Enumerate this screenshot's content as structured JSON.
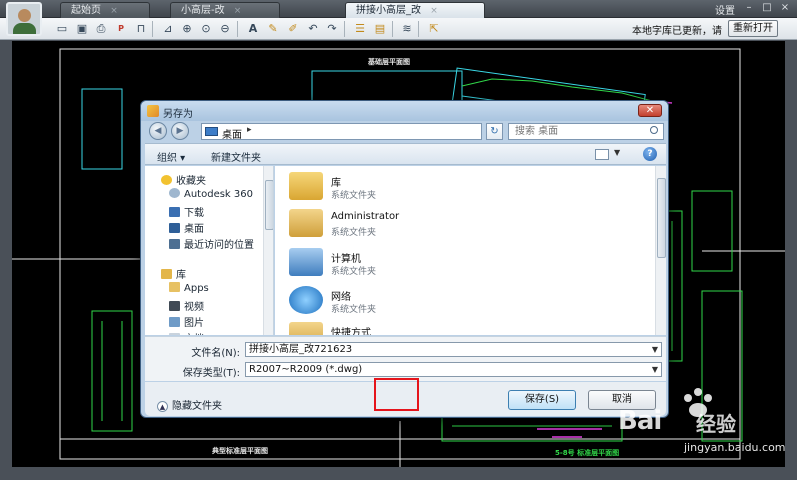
{
  "app": {
    "tabs": [
      {
        "label": "起始页",
        "active": false
      },
      {
        "label": "小高层-改",
        "active": false
      },
      {
        "label": "拼接小高层_改",
        "active": true
      }
    ],
    "settings_label": "设置",
    "window_buttons": {
      "minimize": "–",
      "maximize": "□",
      "close": "×"
    },
    "notice": "本地字库已更新，请",
    "reopen_label": "重新打开"
  },
  "toolbar": {
    "icons": [
      "open-icon",
      "save-icon",
      "print-icon",
      "pdf-icon",
      "lock-icon",
      "measure-icon",
      "zoom-in-icon",
      "zoom-window-icon",
      "zoom-out-icon",
      "text-icon",
      "pen-icon",
      "highlighter-icon",
      "undo-icon",
      "redo-icon",
      "layer-icon",
      "layout-icon",
      "stack-icon",
      "export-icon"
    ]
  },
  "cad": {
    "labels": [
      "典型标准层平面图",
      "基础层平面图",
      "5-8号 标准层平面图"
    ],
    "colors": {
      "line_white": "#e8e8e8",
      "line_green": "#31d84a",
      "line_cyan": "#3ad8e6",
      "line_magenta": "#e040e0"
    }
  },
  "dialog": {
    "title": "另存为",
    "close_label": "✕",
    "back_label": "◀",
    "forward_label": "▶",
    "address": "桌面",
    "address_sep": "▸",
    "refresh_label": "↻",
    "search_placeholder": "搜索 桌面",
    "organize_label": "组织 ▾",
    "new_folder_label": "新建文件夹",
    "help_label": "?",
    "nav": [
      {
        "label": "收藏夹",
        "icon": "star-icon",
        "header": true
      },
      {
        "label": "Autodesk 360",
        "icon": "cloud-icon"
      },
      {
        "label": "下载",
        "icon": "download-folder-icon"
      },
      {
        "label": "桌面",
        "icon": "desktop-icon"
      },
      {
        "label": "最近访问的位置",
        "icon": "recent-icon"
      },
      {
        "label": "库",
        "icon": "library-icon",
        "header": true
      },
      {
        "label": "Apps",
        "icon": "folder-icon"
      },
      {
        "label": "视频",
        "icon": "video-icon"
      },
      {
        "label": "图片",
        "icon": "picture-icon"
      },
      {
        "label": "文档",
        "icon": "document-icon"
      }
    ],
    "files": [
      {
        "name": "库",
        "type": "系统文件夹",
        "icon": "library-folder-icon"
      },
      {
        "name": "Administrator",
        "type": "系统文件夹",
        "icon": "user-folder-icon"
      },
      {
        "name": "计算机",
        "type": "系统文件夹",
        "icon": "computer-icon"
      },
      {
        "name": "网络",
        "type": "系统文件夹",
        "icon": "network-icon"
      },
      {
        "name": "快捷方式",
        "type": "",
        "icon": "shortcut-folder-icon"
      }
    ],
    "filename_label": "文件名(N):",
    "filename_value": "拼接小高层_改721623",
    "filetype_label": "保存类型(T):",
    "filetype_value": "R2007~R2009 (*.dwg)",
    "hide_folders_label": "隐藏文件夹",
    "save_label": "保存(S)",
    "cancel_label": "取消"
  },
  "watermark": {
    "brand": "Bai",
    "brand_cn": "经验",
    "url": "jingyan.baidu.com"
  }
}
